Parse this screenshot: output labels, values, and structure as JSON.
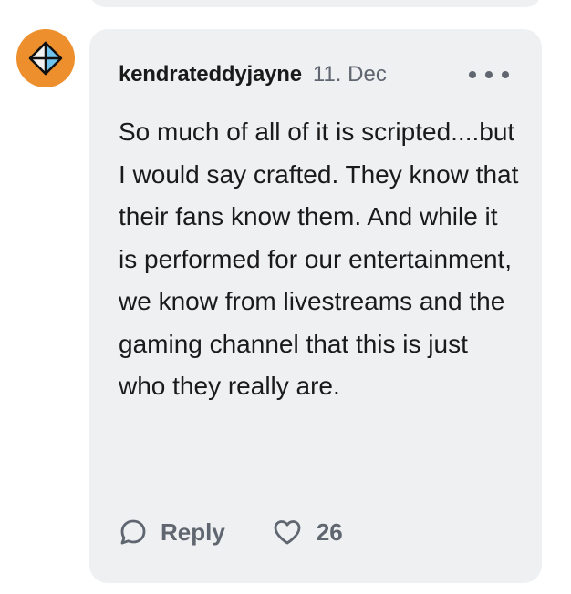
{
  "comment": {
    "username": "kendrateddyjayne",
    "date": "11. Dec",
    "text": "So much of all of it is scripted....but I would say crafted. They know that their fans know them. And while it is performed for our entertainment, we know from livestreams and the gaming channel that this is just who they really are.",
    "reply_label": "Reply",
    "like_count": "26"
  },
  "icons": {
    "avatar": "diamond-avatar-icon",
    "more": "more-horizontal-icon",
    "reply": "speech-bubble-icon",
    "like": "heart-icon"
  },
  "colors": {
    "card_background": "#eef0f2",
    "avatar_background": "#ee8f2e",
    "muted_text": "#5f6670",
    "primary_text": "#1a1a1a"
  }
}
